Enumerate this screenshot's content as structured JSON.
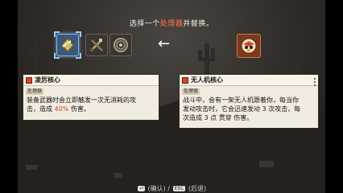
{
  "prompt": {
    "before": "选择一个",
    "highlight": "处理器",
    "after": "并替换。"
  },
  "equipped_slots": [
    {
      "icon": "crystal-core-icon",
      "selected": true
    },
    {
      "icon": "crossed-swords-icon",
      "selected": false
    },
    {
      "icon": "target-rings-icon",
      "selected": false
    }
  ],
  "replace_arrow": "←",
  "new_processor": {
    "icon": "drone-processor-icon"
  },
  "current_card": {
    "title": "凌厉核心",
    "subtitle": "处理器",
    "line1": "装备武器时会立即触发一次无消耗的攻",
    "line2_pre": "击，造成 ",
    "line2_pct": "40%",
    "line2_post": " 伤害。"
  },
  "new_card": {
    "title": "无人机核心",
    "subtitle": "处理器",
    "line1": "战斗中，会有一架无人机跟着你，每当你",
    "line2": "发动攻击时，它会迅速发动 3 次攻击，每",
    "line3": "次造成 3 点 贯穿 伤害。"
  },
  "footer": {
    "confirm_key": "⏎",
    "confirm_label": "(确认)",
    "back_key": "ESC",
    "back_label": "(后退)"
  },
  "colors": {
    "highlight": "#ff7a4d",
    "selected_slot": "#3b5a7a",
    "card_bg": "#f1ece2",
    "damage_pct": "#d2452c"
  }
}
